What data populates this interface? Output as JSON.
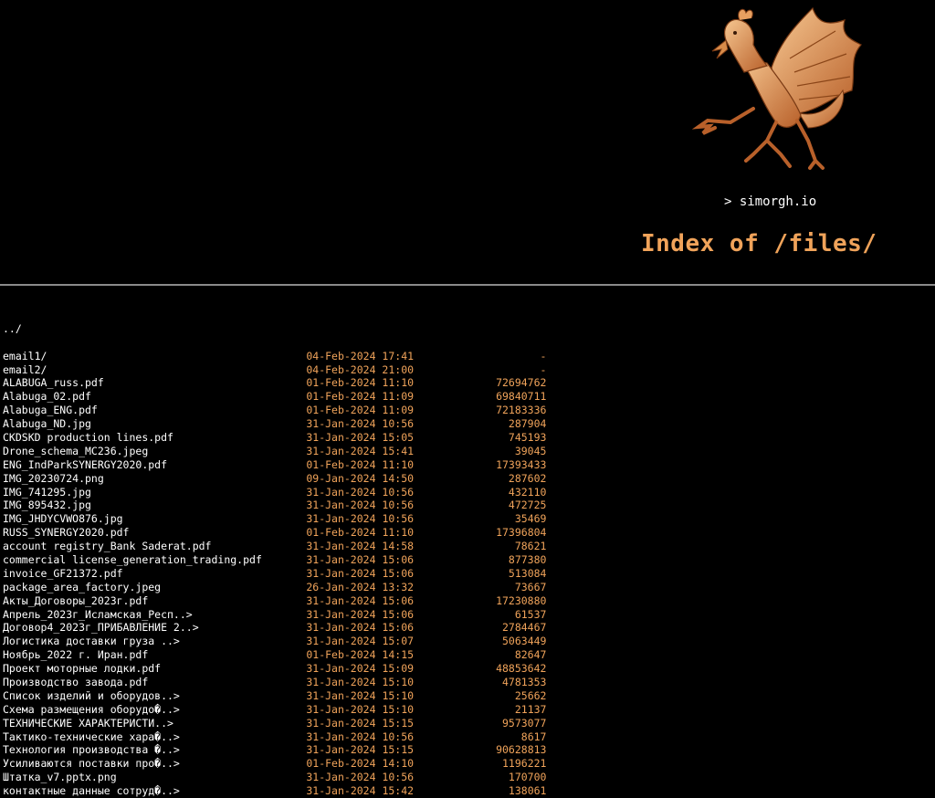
{
  "site": {
    "link": "> simorgh.io",
    "logo_icon": "simorgh-griffin-logo"
  },
  "title": "Index of /files/",
  "colors": {
    "background": "#000000",
    "accent": "#f0a35a",
    "text": "#ffffff"
  },
  "parent": {
    "name": "../"
  },
  "entries": [
    {
      "name": "email1/",
      "date": "04-Feb-2024 17:41",
      "size": "-"
    },
    {
      "name": "email2/",
      "date": "04-Feb-2024 21:00",
      "size": "-"
    },
    {
      "name": "ALABUGA_russ.pdf",
      "date": "01-Feb-2024 11:10",
      "size": "72694762"
    },
    {
      "name": "Alabuga_02.pdf",
      "date": "01-Feb-2024 11:09",
      "size": "69840711"
    },
    {
      "name": "Alabuga_ENG.pdf",
      "date": "01-Feb-2024 11:09",
      "size": "72183336"
    },
    {
      "name": "Alabuga_ND.jpg",
      "date": "31-Jan-2024 10:56",
      "size": "287904"
    },
    {
      "name": "CKDSKD production lines.pdf",
      "date": "31-Jan-2024 15:05",
      "size": "745193"
    },
    {
      "name": "Drone_schema_MC236.jpeg",
      "date": "31-Jan-2024 15:41",
      "size": "39045"
    },
    {
      "name": "ENG_IndParkSYNERGY2020.pdf",
      "date": "01-Feb-2024 11:10",
      "size": "17393433"
    },
    {
      "name": "IMG_20230724.png",
      "date": "09-Jan-2024 14:50",
      "size": "287602"
    },
    {
      "name": "IMG_741295.jpg",
      "date": "31-Jan-2024 10:56",
      "size": "432110"
    },
    {
      "name": "IMG_895432.jpg",
      "date": "31-Jan-2024 10:56",
      "size": "472725"
    },
    {
      "name": "IMG_JHDYCVWO876.jpg",
      "date": "31-Jan-2024 10:56",
      "size": "35469"
    },
    {
      "name": "RUSS_SYNERGY2020.pdf",
      "date": "01-Feb-2024 11:10",
      "size": "17396804"
    },
    {
      "name": "account registry_Bank Saderat.pdf",
      "date": "31-Jan-2024 14:58",
      "size": "78621"
    },
    {
      "name": "commercial license_generation_trading.pdf",
      "date": "31-Jan-2024 15:06",
      "size": "877380"
    },
    {
      "name": "invoice_GF21372.pdf",
      "date": "31-Jan-2024 15:06",
      "size": "513084"
    },
    {
      "name": "package_area_factory.jpeg",
      "date": "26-Jan-2024 13:32",
      "size": "73667"
    },
    {
      "name": "Акты_Договоры_2023г.pdf",
      "date": "31-Jan-2024 15:06",
      "size": "17230880"
    },
    {
      "name": "Апрель_2023г_Исламская_Респ..>",
      "date": "31-Jan-2024 15:06",
      "size": "61537"
    },
    {
      "name": "Договор4_2023г_ПРИБАВЛЕНИЕ 2..>",
      "date": "31-Jan-2024 15:06",
      "size": "2784467"
    },
    {
      "name": "Логистика доставки груза ..>",
      "date": "31-Jan-2024 15:07",
      "size": "5063449"
    },
    {
      "name": "Ноябрь_2022 г. Иран.pdf",
      "date": "01-Feb-2024 14:15",
      "size": "82647"
    },
    {
      "name": "Проект моторные лодки.pdf",
      "date": "31-Jan-2024 15:09",
      "size": "48853642"
    },
    {
      "name": "Производство завода.pdf",
      "date": "31-Jan-2024 15:10",
      "size": "4781353"
    },
    {
      "name": "Список изделий и оборудов..>",
      "date": "31-Jan-2024 15:10",
      "size": "25662"
    },
    {
      "name": "Схема размещения оборудо�..>",
      "date": "31-Jan-2024 15:10",
      "size": "21137"
    },
    {
      "name": "ТЕХНИЧЕСКИЕ ХАРАКТЕРИСТИ..>",
      "date": "31-Jan-2024 15:15",
      "size": "9573077"
    },
    {
      "name": "Тактико-технические хара�..>",
      "date": "31-Jan-2024 10:56",
      "size": "8617"
    },
    {
      "name": "Технология производства �..>",
      "date": "31-Jan-2024 15:15",
      "size": "90628813"
    },
    {
      "name": "Усиливаются поставки про�..>",
      "date": "01-Feb-2024 14:10",
      "size": "1196221"
    },
    {
      "name": "Штатка_v7.pptx.png",
      "date": "31-Jan-2024 10:56",
      "size": "170700"
    },
    {
      "name": "контактные данные сотруд�..>",
      "date": "31-Jan-2024 15:42",
      "size": "138061"
    }
  ]
}
